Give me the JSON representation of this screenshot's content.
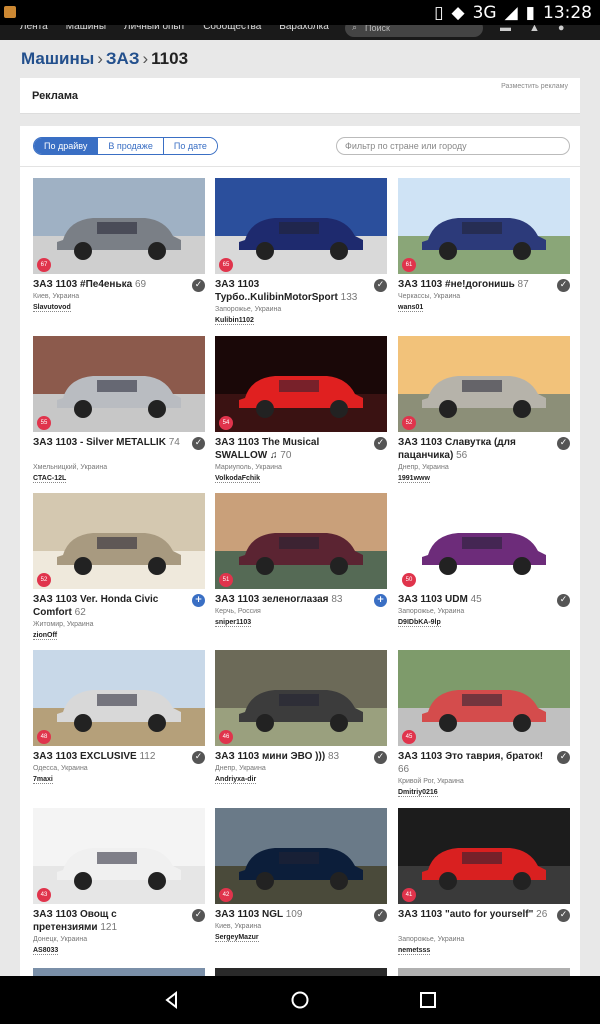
{
  "status_bar": {
    "network": "3G",
    "time": "13:28"
  },
  "site_nav": {
    "links": [
      "Лента",
      "Машины",
      "Личный опыт",
      "Сообщества",
      "Барахолка"
    ],
    "search_placeholder": "Поиск"
  },
  "breadcrumb": {
    "level1": "Машины",
    "level2": "ЗАЗ",
    "current": "1103",
    "separator": "›"
  },
  "ad": {
    "title": "Реклама",
    "link": "Разместить рекламу"
  },
  "filters": {
    "tabs": [
      "По драйву",
      "В продаже",
      "По дате"
    ],
    "active_tab": 0,
    "city_filter_placeholder": "Фильтр по стране или городу"
  },
  "cars": [
    {
      "rank": "67",
      "title": "ЗАЗ 1103 #Пе4енька",
      "views": "69",
      "location": "Киев, Украина",
      "user": "Slavutovod",
      "badge": "check"
    },
    {
      "rank": "65",
      "title": "ЗАЗ 1103 Турбо..KulibinMotorSport",
      "views": "133",
      "location": "Запорожье, Украина",
      "user": "Kulibin1102",
      "badge": "check"
    },
    {
      "rank": "61",
      "title": "ЗАЗ 1103 #не!догонишь",
      "views": "87",
      "location": "Черкассы, Украина",
      "user": "wans01",
      "badge": "check"
    },
    {
      "rank": "55",
      "title": "ЗАЗ 1103 - Silver METALLIK",
      "views": "74",
      "location": "Хмельницкий, Украина",
      "user": "CTAC-12L",
      "badge": "check"
    },
    {
      "rank": "54",
      "title": "ЗАЗ 1103 The Musical SWALLOW ♫",
      "views": "70",
      "location": "Мариуполь, Украина",
      "user": "VolkodaFchik",
      "badge": "check"
    },
    {
      "rank": "52",
      "title": "ЗАЗ 1103 Славутка (для пацанчика)",
      "views": "56",
      "location": "Днепр, Украина",
      "user": "1991www",
      "badge": "check"
    },
    {
      "rank": "52",
      "title": "ЗАЗ 1103 Ver. Honda Civic Comfort",
      "views": "62",
      "location": "Житомир, Украина",
      "user": "zionOff",
      "badge": "plus"
    },
    {
      "rank": "51",
      "title": "ЗАЗ 1103 зеленоглазая",
      "views": "83",
      "location": "Керчь, Россия",
      "user": "sniper1103",
      "badge": "plus"
    },
    {
      "rank": "50",
      "title": "ЗАЗ 1103 UDM",
      "views": "45",
      "location": "Запорожье, Украина",
      "user": "D9IDbKA-9lp",
      "badge": "check"
    },
    {
      "rank": "48",
      "title": "ЗАЗ 1103 EXCLUSIVE",
      "views": "112",
      "location": "Одесса, Украина",
      "user": "7maxi",
      "badge": "check"
    },
    {
      "rank": "46",
      "title": "ЗАЗ 1103 мини ЭВО )))",
      "views": "83",
      "location": "Днепр, Украина",
      "user": "Andriyxa-dir",
      "badge": "check"
    },
    {
      "rank": "45",
      "title": "ЗАЗ 1103 Это таврия, браток!",
      "views": "66",
      "location": "Кривой Рог, Украина",
      "user": "Dmitriy0216",
      "badge": "check"
    },
    {
      "rank": "43",
      "title": "ЗАЗ 1103 Овощ с претензиями",
      "views": "121",
      "location": "Донецк, Украина",
      "user": "AS8033",
      "badge": "check"
    },
    {
      "rank": "42",
      "title": "ЗАЗ 1103 NGL",
      "views": "109",
      "location": "Киев, Украина",
      "user": "SergeyMazur",
      "badge": "check"
    },
    {
      "rank": "41",
      "title": "ЗАЗ 1103 \"auto for yourself\"",
      "views": "26",
      "location": "Запорожье, Украина",
      "user": "nemetsss",
      "badge": "check"
    }
  ],
  "colors": {
    "accent": "#3a6fc4",
    "link": "#23508d",
    "rank_badge": "#e0344c"
  }
}
